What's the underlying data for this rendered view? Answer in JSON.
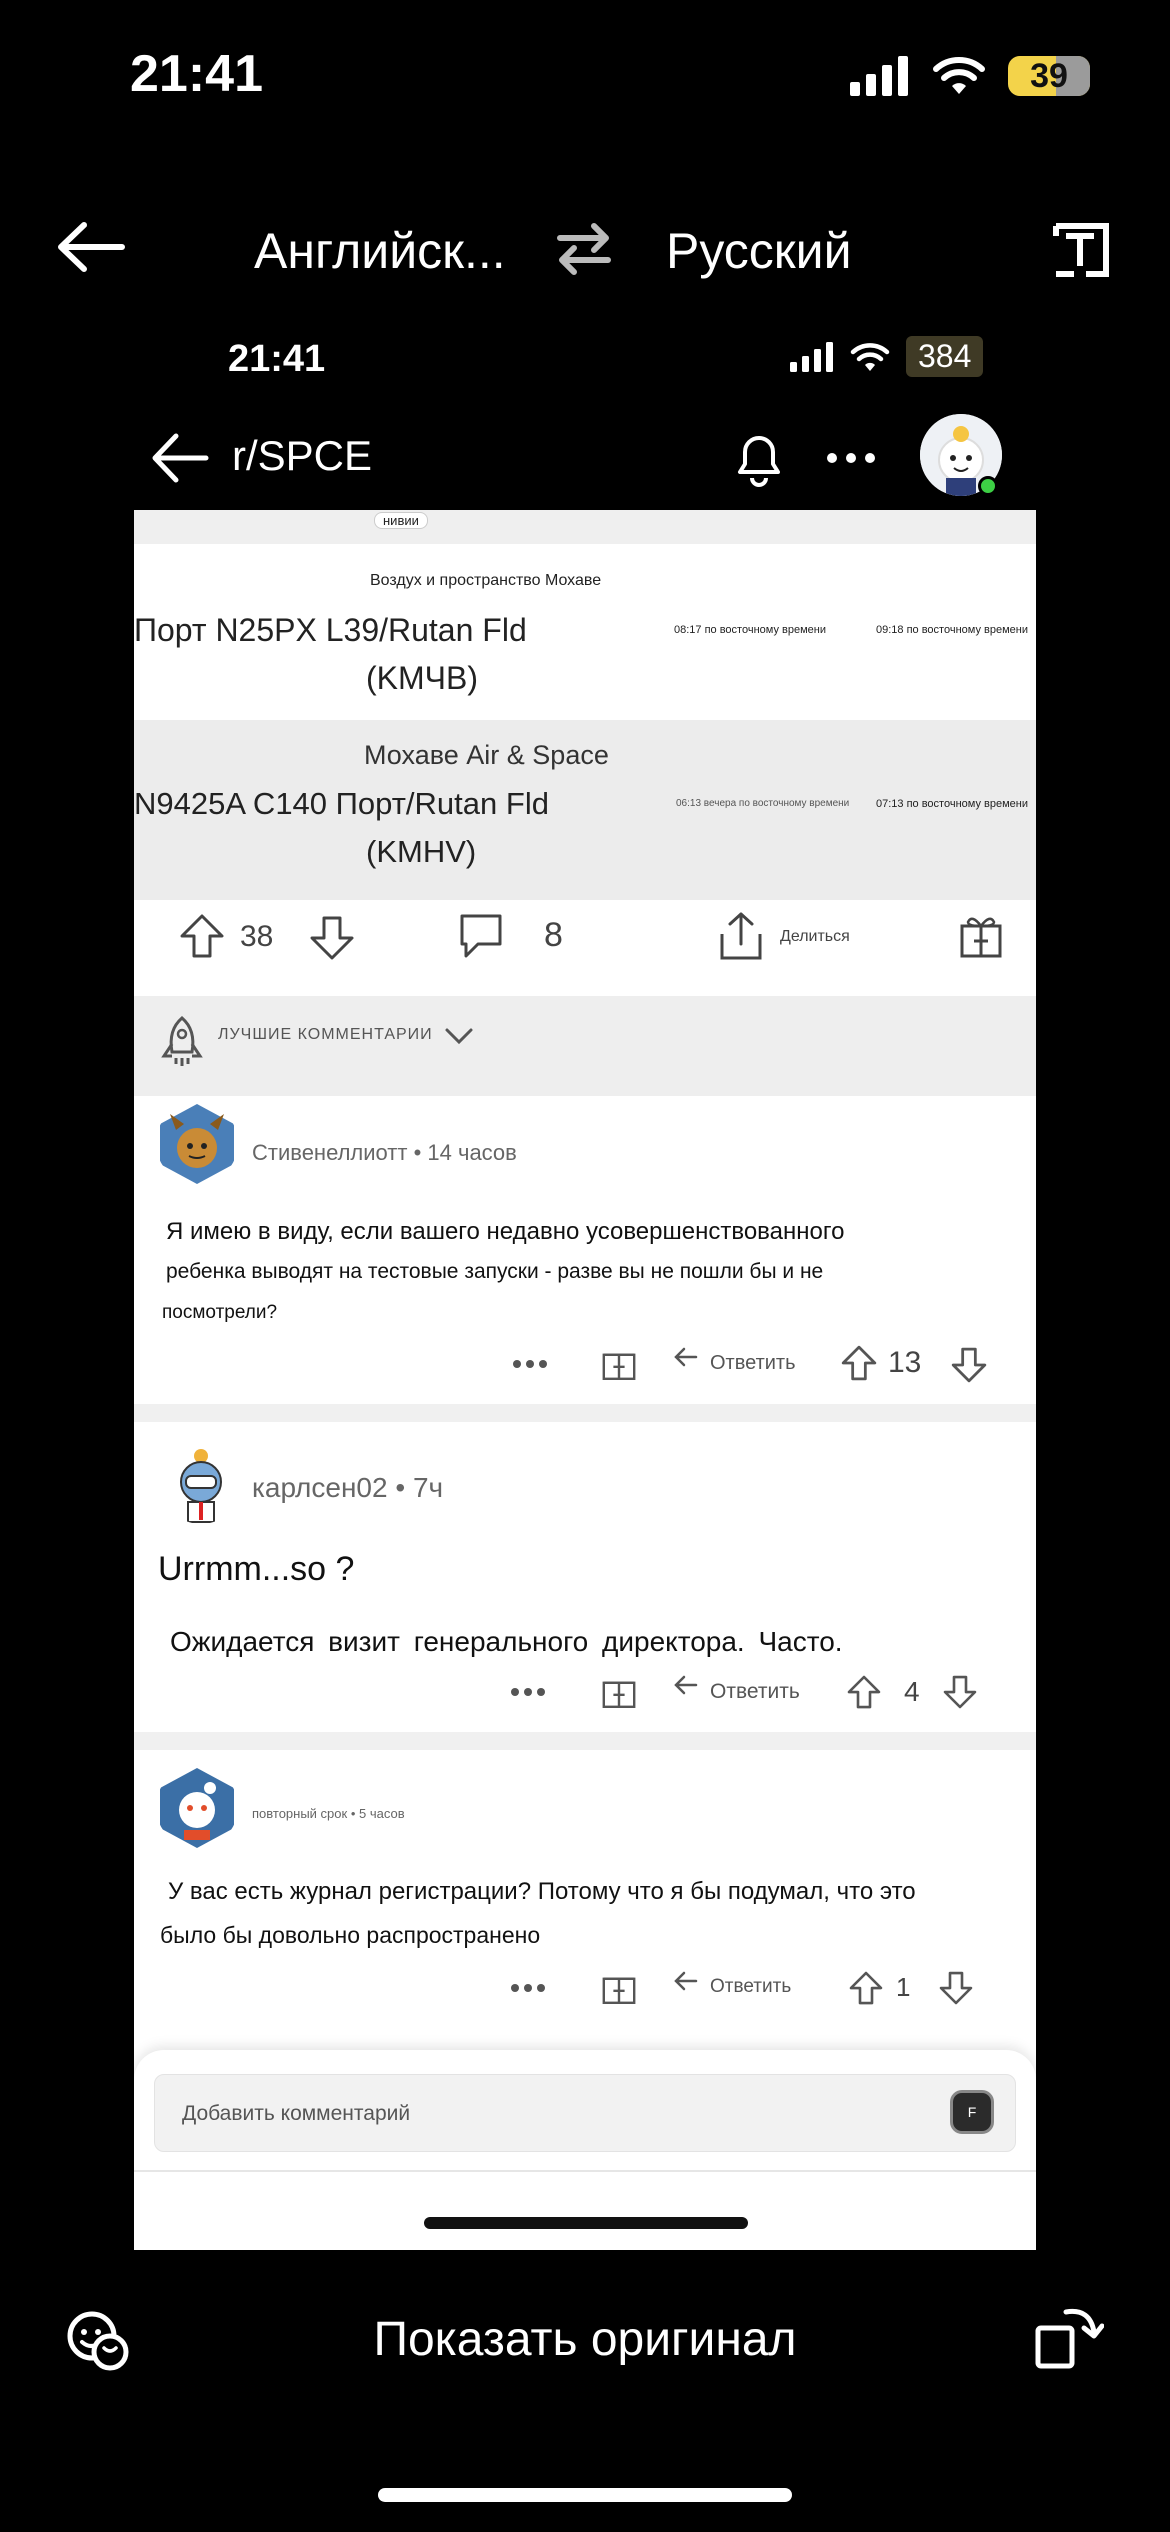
{
  "status_bar": {
    "time": "21:41",
    "battery": "39"
  },
  "translator": {
    "source_lang": "Английск...",
    "target_lang": "Русский",
    "show_original": "Показать оригинал"
  },
  "inner_status": {
    "time": "21:41",
    "battery": "384"
  },
  "reddit_header": {
    "title": "r/SPCE"
  },
  "table": {
    "top_badge": "нивии",
    "row1": {
      "location": "Воздух и пространство Мохаве",
      "flight_line1": "Порт N25PX L39/Rutan Fld",
      "flight_line2": "(KMЧВ)",
      "time1": "08:17 по восточному времени",
      "time2": "09:18 по восточному времени"
    },
    "row2": {
      "location": "Мохаве Air & Space",
      "flight_line1": "N9425A C140 Порт/Rutan Fld",
      "flight_line2": "(KMHV)",
      "time1": "06:13 вечера по восточному времени",
      "time2": "07:13 по восточному времени"
    }
  },
  "post_actions": {
    "votes": "38",
    "comments": "8",
    "share_label": "Делиться"
  },
  "sort": {
    "label": "ЛУЧШИЕ КОММЕНТАРИИ"
  },
  "comments": [
    {
      "author": "Стивенеллиотт",
      "age": "14 часов",
      "body_lines": [
        "Я имею в виду, если вашего недавно усовершенствованного",
        "ребенка выводят на тестовые запуски - разве вы не пошли бы и не",
        "посмотрели?"
      ],
      "reply_label": "Ответить",
      "votes": "13"
    },
    {
      "author": "карлсен02",
      "age": "7ч",
      "body_lines": [
        "Urrmm...so ?",
        "Ожидается визит генерального директора. Часто."
      ],
      "reply_label": "Ответить",
      "votes": "4"
    },
    {
      "author": "повторный срок",
      "age": "5 часов",
      "body_lines": [
        "У вас есть журнал регистрации? Потому что я бы подумал, что это",
        "было бы довольно распространено"
      ],
      "reply_label": "Ответить",
      "votes": "1"
    }
  ],
  "compose": {
    "placeholder": "Добавить комментарий",
    "gif_label": "F"
  }
}
